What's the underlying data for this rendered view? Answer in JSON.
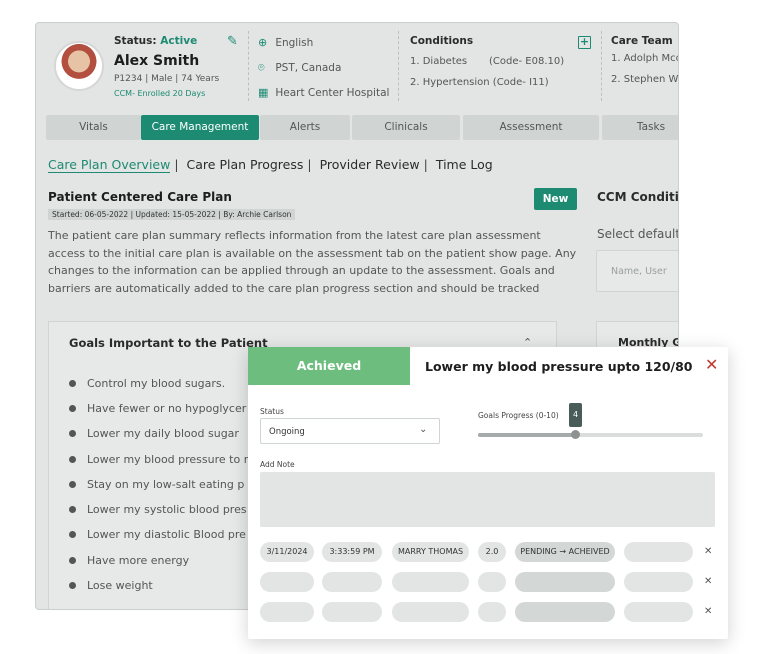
{
  "patient": {
    "status_label": "Status:",
    "status_value": "Active",
    "name": "Alex Smith",
    "meta": "P1234  |  Male  |  74 Years",
    "enrollment": "CCM- Enrolled 20 Days",
    "language": "English",
    "timezone": "PST, Canada",
    "hospital": "Heart Center Hospital"
  },
  "conditions": {
    "title": "Conditions",
    "items": [
      {
        "name": "1. Diabetes",
        "code": "(Code- E08.10)"
      },
      {
        "name": "2. Hypertension (Code- I11)",
        "code": ""
      }
    ]
  },
  "care_team": {
    "title": "Care Team",
    "members": [
      "1. Adolph Mcc",
      "2. Stephen W"
    ]
  },
  "tabs": [
    "Vitals",
    "Care Management",
    "Alerts",
    "Clinicals",
    "Assessment",
    "Tasks"
  ],
  "subnav": [
    "Care Plan Overview",
    "Care Plan Progress",
    "Provider Review",
    "Time Log"
  ],
  "care_plan": {
    "title": "Patient Centered Care Plan",
    "meta": "Started: 06-05-2022 | Updated: 15-05-2022 | By: Archie Carlson",
    "new_label": "New",
    "description": "The patient care plan summary reflects information from the latest care plan assessment access to the initial care plan is available on the assessment tab on the patient show page. Any changes to the information can be applied through an update to the assessment. Goals and barriers are automatically added to the care plan progress section and should be tracked"
  },
  "goals": {
    "title": "Goals Important to the Patient",
    "items": [
      "Control my blood sugars.",
      "Have fewer or no hypoglycer",
      "Lower  my daily blood sugar",
      "Lower my blood pressure to r",
      "Stay on my low-salt eating p",
      "Lower my systolic blood pres",
      "Lower my diastolic Blood pre",
      "Have more energy",
      "Lose weight"
    ]
  },
  "right_col": {
    "title": "CCM Condition",
    "subtitle": "Select default",
    "input_placeholder": "Name, User",
    "monthly_title": "Monthly Go"
  },
  "modal": {
    "badge": "Achieved",
    "goal_title": "Lower my blood pressure upto 120/80",
    "status_label": "Status",
    "status_value": "Ongoing",
    "progress_label": "Goals Progress (0-10)",
    "progress_value": "4",
    "progress_fraction": 0.43,
    "note_label": "Add Note",
    "log_entry": {
      "date": "3/11/2024",
      "time": "3:33:59 PM",
      "user": "MARRY THOMAS",
      "version": "2.0",
      "transition": "PENDING → ACHEIVED"
    }
  },
  "colors": {
    "accent": "#1d8a72",
    "achieved": "#6dbe7e",
    "close": "#c0392b"
  }
}
